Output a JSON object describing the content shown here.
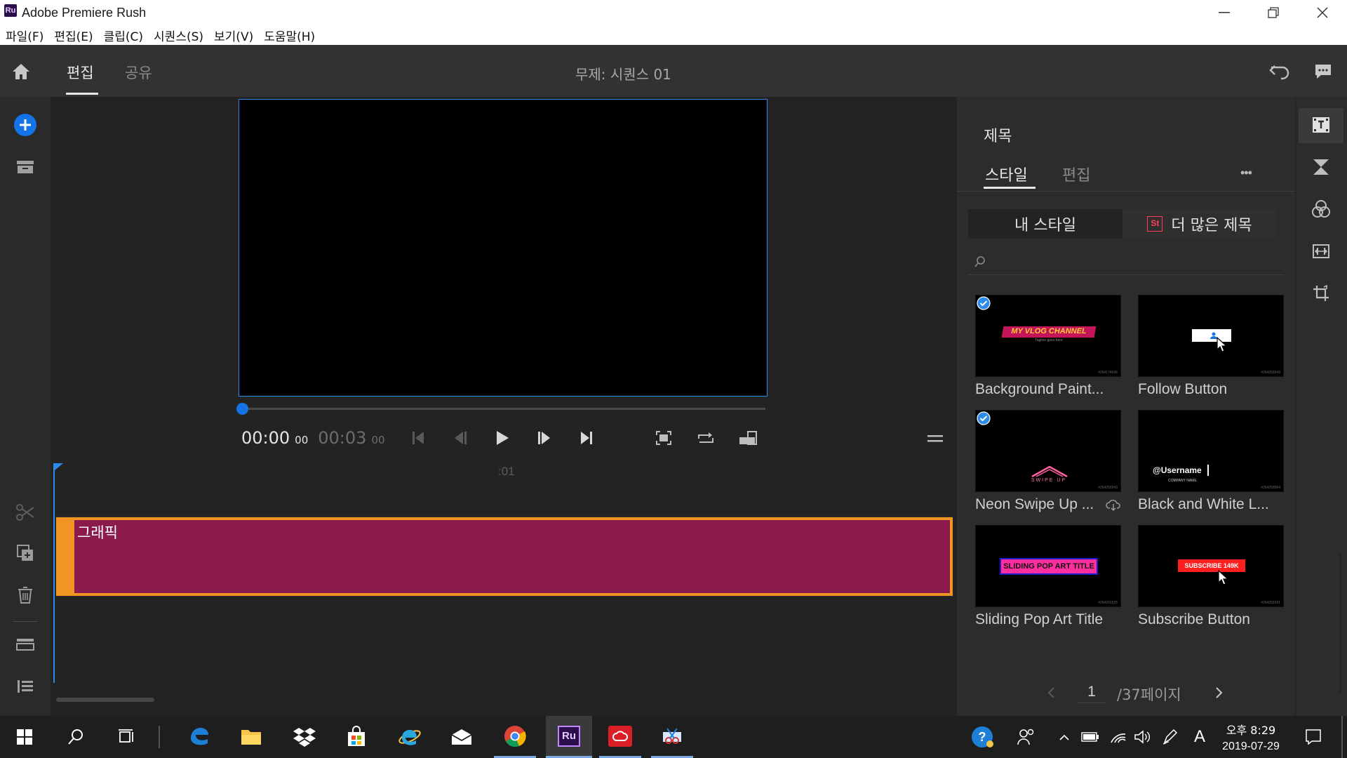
{
  "window": {
    "app_icon": "Ru",
    "title": "Adobe Premiere Rush"
  },
  "menu": [
    "파일(F)",
    "편집(E)",
    "클립(C)",
    "시퀀스(S)",
    "보기(V)",
    "도움말(H)"
  ],
  "header": {
    "tab_edit": "편집",
    "tab_share": "공유",
    "sequence_title": "무제: 시퀀스 01"
  },
  "player": {
    "current_time": "00:00",
    "current_frames": "00",
    "total_time": "00:03",
    "total_frames": "00",
    "progress": 0
  },
  "timeline": {
    "ruler_mark": ":01",
    "clip_label": "그래픽"
  },
  "panel": {
    "title": "제목",
    "tab_style": "스타일",
    "tab_edit": "편집",
    "more": "•••",
    "my_styles": "내 스타일",
    "stock_badge": "St",
    "more_titles": "더 많은 제목",
    "templates": [
      {
        "name": "Background Paint...",
        "checked": true,
        "thumb_text": "MY VLOG CHANNEL",
        "thumb_sub": "Tagline goes here",
        "thumb_id": "#264174636"
      },
      {
        "name": "Follow Button",
        "checked": false,
        "thumb_text": "",
        "thumb_sub": "",
        "thumb_id": "#264258249"
      },
      {
        "name": "Neon Swipe Up ...",
        "checked": true,
        "thumb_text": "SWIPE UP",
        "thumb_sub": "",
        "thumb_id": "#264258243"
      },
      {
        "name": "Black and White L...",
        "checked": false,
        "thumb_text": "@Username",
        "thumb_sub": "COMPANY NAME",
        "thumb_id": "#264258064"
      },
      {
        "name": "Sliding Pop Art Title",
        "checked": false,
        "thumb_text": "SLIDING POP ART TITLE",
        "thumb_sub": "",
        "thumb_id": "#264261525"
      },
      {
        "name": "Subscribe Button",
        "checked": false,
        "thumb_text": "SUBSCRIBE 149K",
        "thumb_sub": "",
        "thumb_id": "#264258291"
      }
    ],
    "page_current": "1",
    "page_total": "/37페이지"
  },
  "taskbar": {
    "time": "오후 8:29",
    "date": "2019-07-29",
    "ime": "A",
    "ru_label": "Ru"
  },
  "colors": {
    "accent_blue": "#1473e6",
    "clip_magenta": "#8a1b4c",
    "clip_orange": "#f29423",
    "playhead": "#2d8ceb"
  }
}
